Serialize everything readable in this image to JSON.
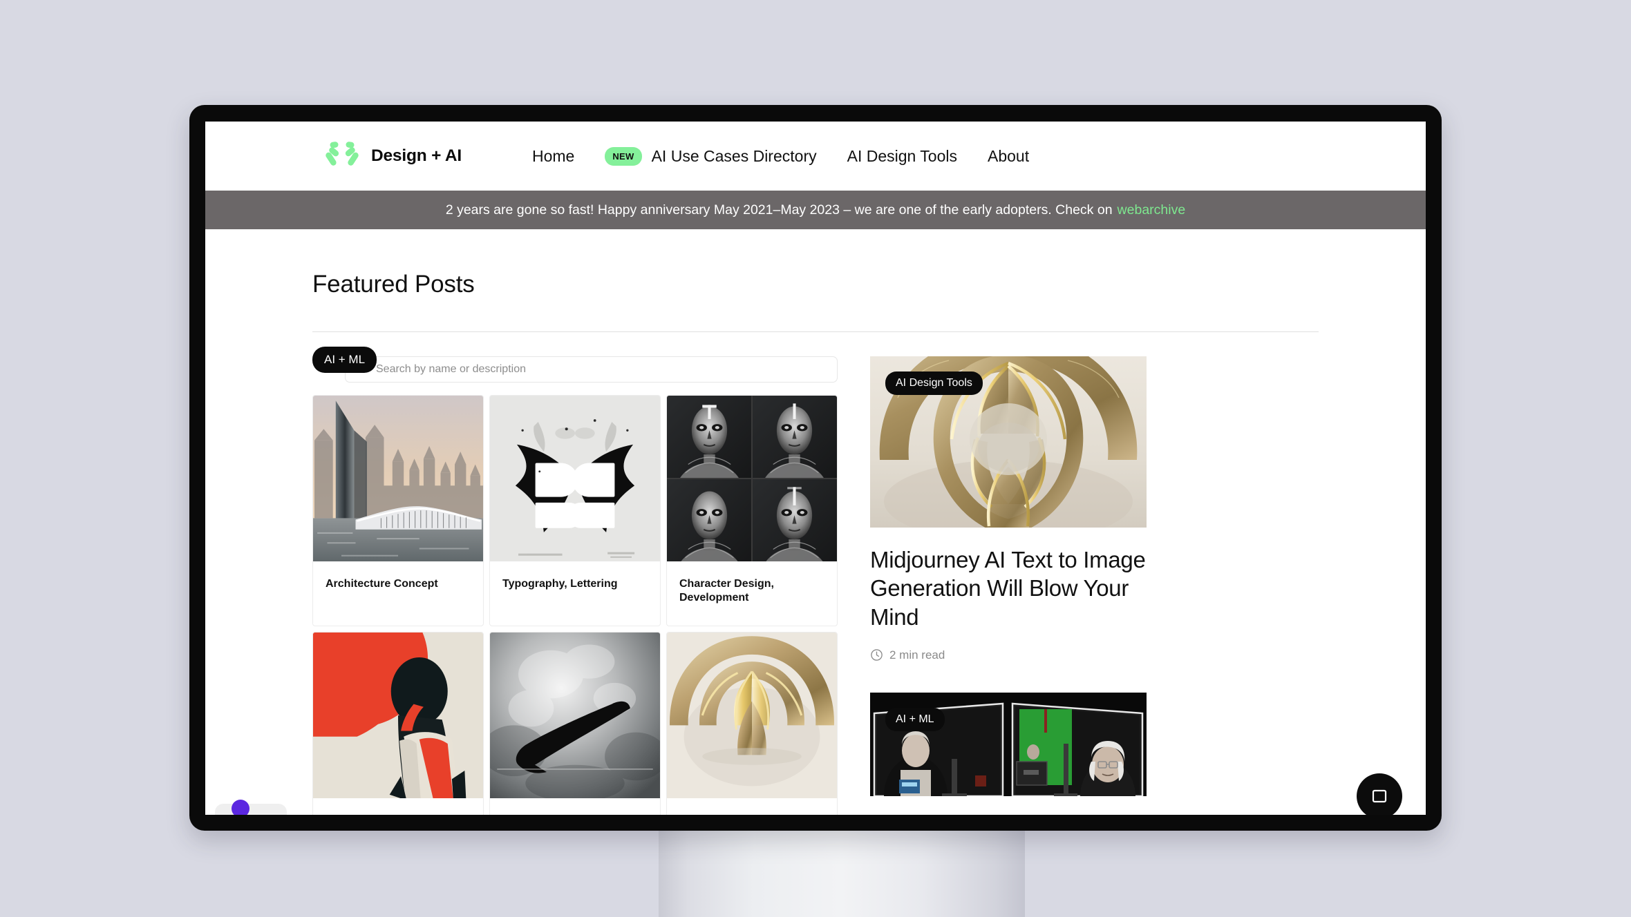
{
  "brand": {
    "name": "Design + AI",
    "logo_icon": "two-figures-logo-icon",
    "logo_color": "#84f09a"
  },
  "nav": {
    "items": [
      {
        "label": "Home",
        "badge": null
      },
      {
        "label": "AI Use Cases Directory",
        "badge": "NEW"
      },
      {
        "label": "AI Design Tools",
        "badge": null
      },
      {
        "label": "About",
        "badge": null
      }
    ],
    "badge_color": "#84f09a"
  },
  "announcement": {
    "text": "2 years are gone so fast! Happy anniversary May 2021–May 2023 – we are one of the early adopters. Check on",
    "link_label": "webarchive",
    "background": "#6b6768",
    "link_color": "#7ee88f"
  },
  "main": {
    "section_title": "Featured Posts",
    "search": {
      "placeholder": "Search by name or description",
      "value": "",
      "icon": "search-icon"
    },
    "category_pill": "AI + ML",
    "posts": [
      {
        "caption": "Architecture Concept",
        "thumb": "architecture-concept-thumbnail"
      },
      {
        "caption": "Typography, Lettering",
        "thumb": "typography-lettering-thumbnail"
      },
      {
        "caption": "Character Design, Development",
        "thumb": "character-design-thumbnail"
      },
      {
        "caption": "",
        "thumb": "portrait-red-poster-thumbnail"
      },
      {
        "caption": "",
        "thumb": "nike-swoosh-thumbnail"
      },
      {
        "caption": "",
        "thumb": "gold-sculpture-thumbnail"
      }
    ]
  },
  "sidebar": {
    "feature": {
      "tag": "AI Design Tools",
      "title": "Midjourney AI Text to Image Generation Will Blow Your Mind",
      "read_time": "2 min read",
      "clock_icon": "clock-icon",
      "image": "gold-torus-sculpture-image"
    },
    "second_feature": {
      "tag": "AI + ML",
      "image": "studio-green-screen-video-image"
    }
  },
  "widgets": {
    "chat_fab": {
      "icon": "chat-bookmark-icon",
      "color": "#0c0c0c"
    },
    "cookie_chip": {
      "color": "#5b27e0"
    }
  }
}
